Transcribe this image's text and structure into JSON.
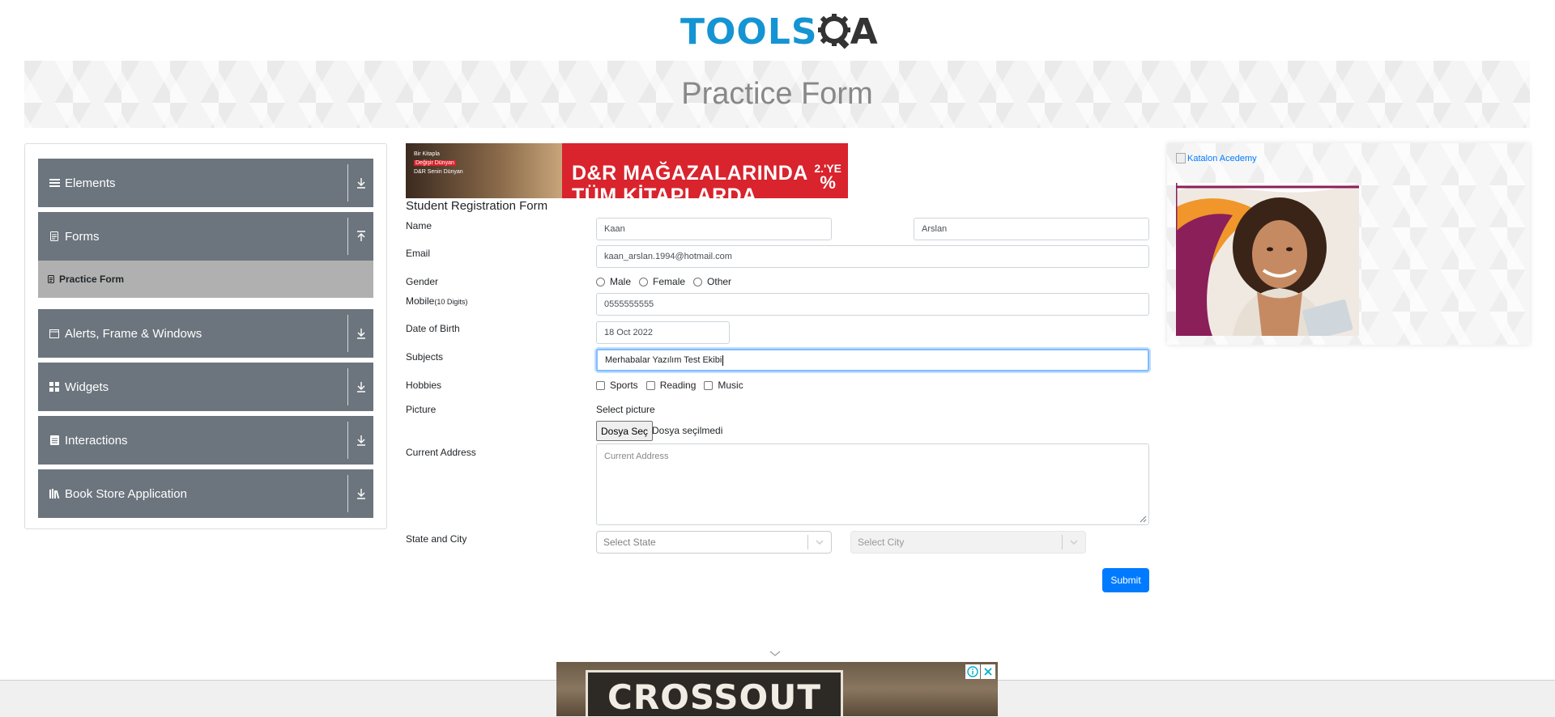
{
  "logo": {
    "part1": "TOOLS",
    "part2_q": "Q",
    "part2_a": "A"
  },
  "banner": {
    "title": "Practice Form"
  },
  "sidebar": {
    "groups": [
      {
        "label": "Elements",
        "icon": "hamburger-icon",
        "arrow": "down"
      },
      {
        "label": "Forms",
        "icon": "document-icon",
        "arrow": "up",
        "subitems": [
          {
            "label": "Practice Form",
            "icon": "document-icon"
          }
        ]
      },
      {
        "label": "Alerts, Frame & Windows",
        "icon": "window-icon",
        "arrow": "down"
      },
      {
        "label": "Widgets",
        "icon": "grid-icon",
        "arrow": "down"
      },
      {
        "label": "Interactions",
        "icon": "list-icon",
        "arrow": "down"
      },
      {
        "label": "Book Store Application",
        "icon": "books-icon",
        "arrow": "down"
      }
    ]
  },
  "ad_top": {
    "left_line1": "Bir Kitapla",
    "left_line2": "Değişir Dünyan",
    "left_line3": "D&R Senin Dünyan",
    "headline": "D&R MAĞAZALARINDA",
    "headline2": "TÜM KİTAPLARDA",
    "side_text": "2.'YE",
    "side_percent": "%"
  },
  "form": {
    "title": "Student Registration Form",
    "labels": {
      "name": "Name",
      "email": "Email",
      "gender": "Gender",
      "mobile": "Mobile",
      "mobile_hint": "(10 Digits)",
      "dob": "Date of Birth",
      "subjects": "Subjects",
      "hobbies": "Hobbies",
      "picture": "Picture",
      "address": "Current Address",
      "state_city": "State and City"
    },
    "first_name": "Kaan",
    "last_name": "Arslan",
    "email": "kaan_arslan.1994@hotmail.com",
    "gender_options": [
      "Male",
      "Female",
      "Other"
    ],
    "mobile": "0555555555",
    "dob": "18 Oct 2022",
    "subjects": "Merhabalar Yazılım Test Ekibi",
    "hobby_options": [
      "Sports",
      "Reading",
      "Music"
    ],
    "picture_label": "Select picture",
    "file_button": "Dosya Seç",
    "file_status": "Dosya seçilmedi",
    "address_placeholder": "Current Address",
    "state_placeholder": "Select State",
    "city_placeholder": "Select City",
    "submit": "Submit"
  },
  "right_panel": {
    "image_alt": "Katalon Acedemy"
  },
  "ad_bottom": {
    "title": "CROSSOUT"
  },
  "colors": {
    "sidebar_group": "#6c757d",
    "accent": "#007bff",
    "logo_blue": "#1594d3",
    "ad_red": "#d9232d"
  }
}
